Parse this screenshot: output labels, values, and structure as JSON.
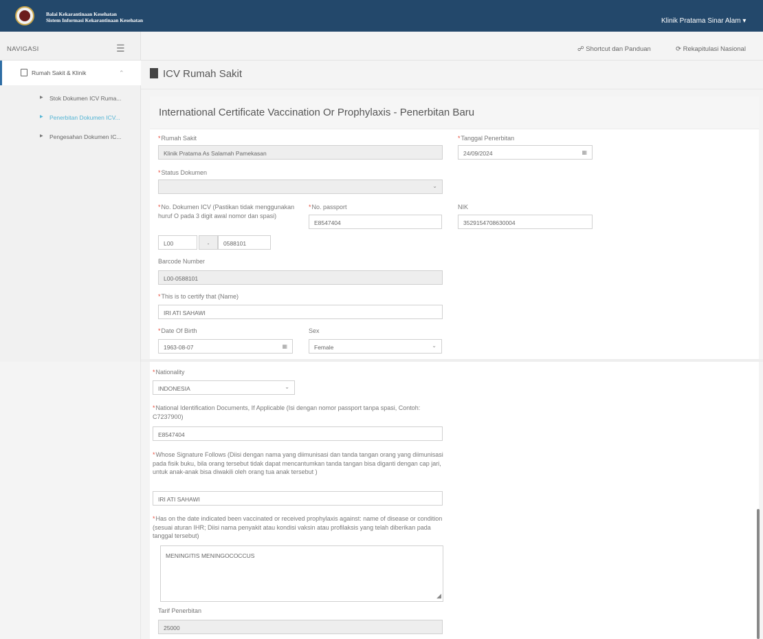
{
  "app": {
    "brand_line1": "Balai Kekarantinaan Kesehatan",
    "brand_line2": "Sistem Informasi Kekarantinaan Kesehatan",
    "user": "Klinik Pratama Sinar Alam ▾"
  },
  "sidebar": {
    "title": "NAVIGASI",
    "group": "Rumah Sakit & Klinik",
    "items": [
      {
        "label": "Stok Dokumen ICV Ruma..."
      },
      {
        "label": "Penerbitan Dokumen ICV..."
      },
      {
        "label": "Pengesahan Dokumen IC..."
      }
    ]
  },
  "toolbar": {
    "shortcut": "☍ Shortcut dan Panduan",
    "rekap": "⟳ Rekapitulasi Nasional"
  },
  "page": {
    "title": "ICV Rumah Sakit",
    "panel_title": "International Certificate Vaccination Or Prophylaxis - Penerbitan Baru"
  },
  "form": {
    "rumah_sakit": {
      "label": "Rumah Sakit",
      "value": "Klinik Pratama As Salamah Pamekasan"
    },
    "tanggal": {
      "label": "Tanggal Penerbitan",
      "value": "24/09/2024"
    },
    "status": {
      "label": "Status Dokumen",
      "value": ""
    },
    "no_dok": {
      "label": "No. Dokumen ICV (Pastikan tidak menggunakan huruf O pada 3 digit awal nomor dan spasi)",
      "prefix": "L00",
      "sep": "-",
      "number": "0588101"
    },
    "passport": {
      "label": "No. passport",
      "value": "E8547404"
    },
    "nik": {
      "label": "NIK",
      "value": "3529154708630004"
    },
    "barcode": {
      "label": "Barcode Number",
      "value": "L00-0588101"
    },
    "name": {
      "label": "This is to certify that (Name)",
      "value": "IRI ATI SAHAWI"
    },
    "dob": {
      "label": "Date Of Birth",
      "value": "1963-08-07"
    },
    "sex": {
      "label": "Sex",
      "value": "Female"
    },
    "nationality": {
      "label": "Nationality",
      "value": "INDONESIA"
    },
    "national_id": {
      "label": "National Identification Documents, If Applicable (Isi dengan nomor passport tanpa spasi, Contoh: C7237900)",
      "value": "E8547404"
    },
    "signature": {
      "label": "Whose Signature Follows (Diisi dengan nama yang diimunisasi dan tanda tangan orang yang diimunisasi pada fisik buku, bila orang tersebut tidak dapat mencantumkan tanda tangan bisa diganti dengan cap jari, untuk anak-anak bisa diwakili oleh orang tua anak tersebut )",
      "value": "IRI ATI SAHAWI"
    },
    "disease": {
      "label": "Has on the date indicated been vaccinated or received prophylaxis against: name of disease or condition (sesuai aturan IHR; Diisi nama penyakit atau kondisi vaksin atau profilaksis yang telah diberikan pada tanggal tersebut)",
      "value": "MENINGITIS MENINGOCOCCUS"
    },
    "tarif": {
      "label": "Tarif Penerbitan",
      "value": "25000"
    }
  }
}
